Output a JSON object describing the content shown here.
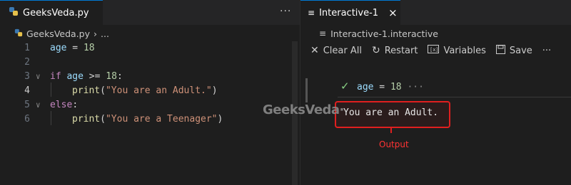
{
  "left": {
    "tab_label": "GeeksVeda.py",
    "more_label": "···",
    "breadcrumb": {
      "file": "GeeksVeda.py",
      "sep": "›",
      "rest": "..."
    },
    "lines": [
      {
        "num": "1"
      },
      {
        "num": "2"
      },
      {
        "num": "3"
      },
      {
        "num": "4"
      },
      {
        "num": "5"
      },
      {
        "num": "6"
      }
    ],
    "code": {
      "l1_var": "age",
      "l1_op": " = ",
      "l1_num": "18",
      "l3_kw": "if",
      "l3_var": " age",
      "l3_op": " >= ",
      "l3_num": "18",
      "l3_colon": ":",
      "l4_fn": "print",
      "l4_open": "(",
      "l4_str": "\"You are an Adult.\"",
      "l4_close": ")",
      "l5_kw": "else",
      "l5_colon": ":",
      "l6_fn": "print",
      "l6_open": "(",
      "l6_str": "\"You are a Teenager\"",
      "l6_close": ")"
    }
  },
  "right": {
    "tab_label": "Interactive-1",
    "close_label": "×",
    "breadcrumb": "Interactive-1.interactive",
    "toolbar": {
      "clear_all": "Clear All",
      "restart": "Restart",
      "variables": "Variables",
      "save": "Save",
      "more": "···"
    },
    "cell": {
      "var": "age",
      "op": " = ",
      "num": "18",
      "ellipsis": " ···"
    },
    "output_text": "You are an Adult.",
    "output_label": "Output"
  },
  "watermark": "GeeksVeda·",
  "colors": {
    "accent": "#0078d4",
    "highlight": "#e01f1f",
    "success": "#89d185"
  }
}
